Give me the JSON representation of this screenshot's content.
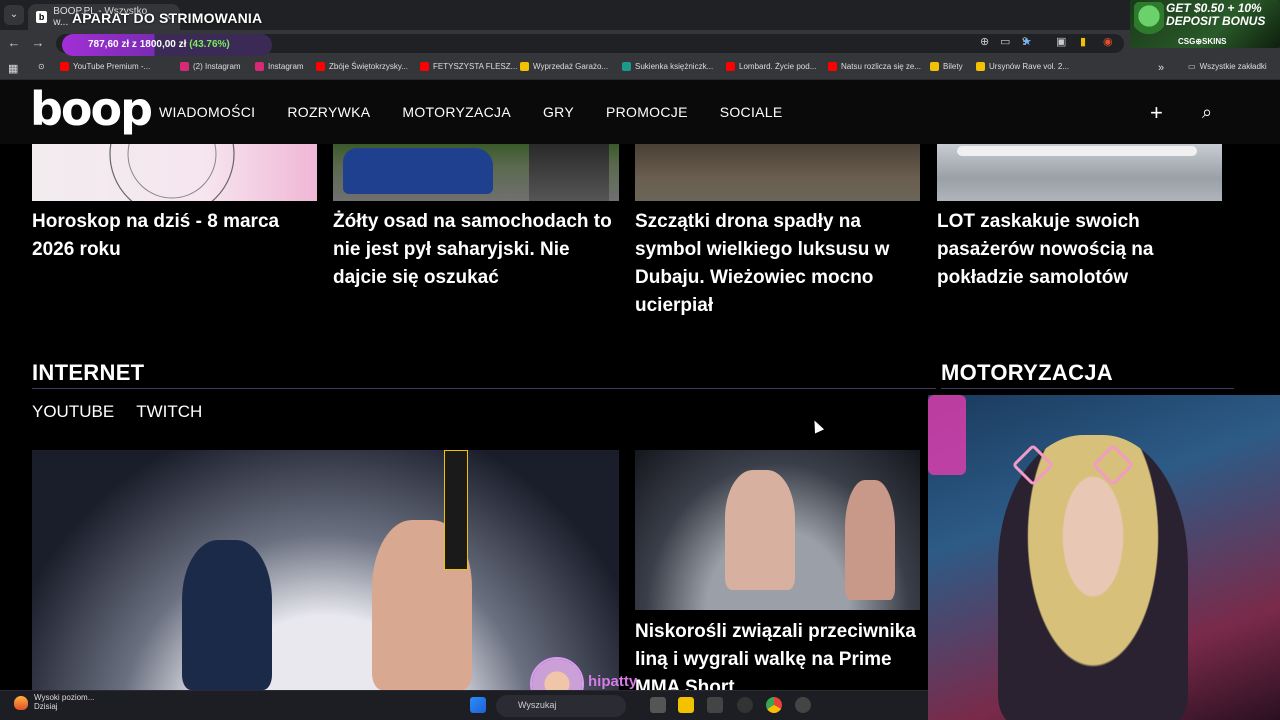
{
  "browser": {
    "tab_title": "BOOP.PL - Wszystko w...",
    "overlay_title": "APARAT DO STRIMOWANIA",
    "bookmarks_all": "Wszystkie zakładki",
    "bookmarks": [
      {
        "label": "YouTube Premium -...",
        "color": "#ff0000"
      },
      {
        "label": "(2) Instagram",
        "color": "#d62976"
      },
      {
        "label": "Instagram",
        "color": "#d62976"
      },
      {
        "label": "Zbóje Świętokrzysky...",
        "color": "#ff0000"
      },
      {
        "label": "FETYSZYSTA FLESZ...",
        "color": "#ff0000"
      },
      {
        "label": "Wyprzedaż Garażo...",
        "color": "#f2c200"
      },
      {
        "label": "Sukienka księżniczk...",
        "color": "#1a9a8a"
      },
      {
        "label": "Lombard. Życie pod...",
        "color": "#ff0000"
      },
      {
        "label": "Natsu rozlicza się ze...",
        "color": "#ff0000"
      },
      {
        "label": "Bilety",
        "color": "#f2c200"
      },
      {
        "label": "Ursynów Rave vol. 2...",
        "color": "#f2c200"
      }
    ]
  },
  "donation_goal": {
    "text": "787,60 zł z 1800,00 zł",
    "percent_text": "(43.76%)",
    "fraction": 0.4376
  },
  "promo": {
    "line1": "GET $0.50 + 10%",
    "line2": "DEPOSIT BONUS",
    "brand": "CSG⊕SKINS"
  },
  "site": {
    "logo": "boop",
    "nav": [
      "WIADOMOŚCI",
      "ROZRYWKA",
      "MOTORYZACJA",
      "GRY",
      "PROMOCJE",
      "SOCIALE"
    ]
  },
  "top_cards": [
    {
      "title": "Horoskop na dziś - 8 marca 2026 roku"
    },
    {
      "title": "Żółty osad na samochodach to nie jest pył saharyjski. Nie dajcie się oszukać"
    },
    {
      "title": "Szczątki drona spadły na symbol wielkiego luksusu w Dubaju. Wieżowiec mocno ucierpiał"
    },
    {
      "title": "LOT zaskakuje swoich pasażerów nowością na pokładzie samolotów"
    }
  ],
  "sections": {
    "internet": "INTERNET",
    "motoryzacja": "MOTORYZACJA",
    "subtabs": [
      "YOUTUBE",
      "TWITCH"
    ]
  },
  "internet_cards": [
    {
      "title": "Niskorośli związali przeciwnika liną i wygrali walkę na Prime MMA Short"
    }
  ],
  "taskbar": {
    "notif_title": "Wysoki poziom...",
    "notif_sub": "Dzisiaj",
    "search_placeholder": "Wyszukaj"
  },
  "stream": {
    "username": "hipatty"
  }
}
